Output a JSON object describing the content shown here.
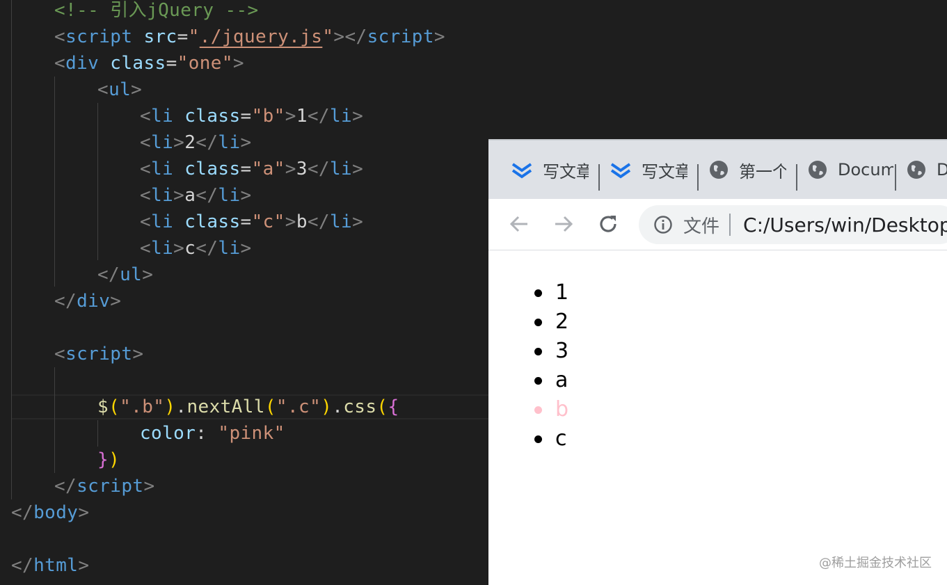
{
  "editor": {
    "lines": [
      {
        "segments": [
          {
            "c": "t-com",
            "t": "<!-- 引入jQuery -->"
          }
        ]
      },
      {
        "segments": [
          {
            "c": "t-gray",
            "t": "<"
          },
          {
            "c": "t-tag",
            "t": "script"
          },
          {
            "c": "t-text",
            "t": " "
          },
          {
            "c": "t-attr",
            "t": "src"
          },
          {
            "c": "t-text",
            "t": "="
          },
          {
            "c": "t-str",
            "t": "\""
          },
          {
            "c": "t-str ul-link",
            "t": "./jquery.js"
          },
          {
            "c": "t-str",
            "t": "\""
          },
          {
            "c": "t-gray",
            "t": "></"
          },
          {
            "c": "t-tag",
            "t": "script"
          },
          {
            "c": "t-gray",
            "t": ">"
          }
        ]
      },
      {
        "segments": [
          {
            "c": "t-gray",
            "t": "<"
          },
          {
            "c": "t-tag",
            "t": "div"
          },
          {
            "c": "t-text",
            "t": " "
          },
          {
            "c": "t-attr",
            "t": "class"
          },
          {
            "c": "t-text",
            "t": "="
          },
          {
            "c": "t-str",
            "t": "\"one\""
          },
          {
            "c": "t-gray",
            "t": ">"
          }
        ]
      },
      {
        "segments": [
          {
            "c": "t-gray",
            "t": "<"
          },
          {
            "c": "t-tag",
            "t": "ul"
          },
          {
            "c": "t-gray",
            "t": ">"
          }
        ]
      },
      {
        "segments": [
          {
            "c": "t-gray",
            "t": "<"
          },
          {
            "c": "t-tag",
            "t": "li"
          },
          {
            "c": "t-text",
            "t": " "
          },
          {
            "c": "t-attr",
            "t": "class"
          },
          {
            "c": "t-text",
            "t": "="
          },
          {
            "c": "t-str",
            "t": "\"b\""
          },
          {
            "c": "t-gray",
            "t": ">"
          },
          {
            "c": "t-text",
            "t": "1"
          },
          {
            "c": "t-gray",
            "t": "</"
          },
          {
            "c": "t-tag",
            "t": "li"
          },
          {
            "c": "t-gray",
            "t": ">"
          }
        ]
      },
      {
        "segments": [
          {
            "c": "t-gray",
            "t": "<"
          },
          {
            "c": "t-tag",
            "t": "li"
          },
          {
            "c": "t-gray",
            "t": ">"
          },
          {
            "c": "t-text",
            "t": "2"
          },
          {
            "c": "t-gray",
            "t": "</"
          },
          {
            "c": "t-tag",
            "t": "li"
          },
          {
            "c": "t-gray",
            "t": ">"
          }
        ]
      },
      {
        "segments": [
          {
            "c": "t-gray",
            "t": "<"
          },
          {
            "c": "t-tag",
            "t": "li"
          },
          {
            "c": "t-text",
            "t": " "
          },
          {
            "c": "t-attr",
            "t": "class"
          },
          {
            "c": "t-text",
            "t": "="
          },
          {
            "c": "t-str",
            "t": "\"a\""
          },
          {
            "c": "t-gray",
            "t": ">"
          },
          {
            "c": "t-text",
            "t": "3"
          },
          {
            "c": "t-gray",
            "t": "</"
          },
          {
            "c": "t-tag",
            "t": "li"
          },
          {
            "c": "t-gray",
            "t": ">"
          }
        ]
      },
      {
        "segments": [
          {
            "c": "t-gray",
            "t": "<"
          },
          {
            "c": "t-tag",
            "t": "li"
          },
          {
            "c": "t-gray",
            "t": ">"
          },
          {
            "c": "t-text",
            "t": "a"
          },
          {
            "c": "t-gray",
            "t": "</"
          },
          {
            "c": "t-tag",
            "t": "li"
          },
          {
            "c": "t-gray",
            "t": ">"
          }
        ]
      },
      {
        "segments": [
          {
            "c": "t-gray",
            "t": "<"
          },
          {
            "c": "t-tag",
            "t": "li"
          },
          {
            "c": "t-text",
            "t": " "
          },
          {
            "c": "t-attr",
            "t": "class"
          },
          {
            "c": "t-text",
            "t": "="
          },
          {
            "c": "t-str",
            "t": "\"c\""
          },
          {
            "c": "t-gray",
            "t": ">"
          },
          {
            "c": "t-text",
            "t": "b"
          },
          {
            "c": "t-gray",
            "t": "</"
          },
          {
            "c": "t-tag",
            "t": "li"
          },
          {
            "c": "t-gray",
            "t": ">"
          }
        ]
      },
      {
        "segments": [
          {
            "c": "t-gray",
            "t": "<"
          },
          {
            "c": "t-tag",
            "t": "li"
          },
          {
            "c": "t-gray",
            "t": ">"
          },
          {
            "c": "t-text",
            "t": "c"
          },
          {
            "c": "t-gray",
            "t": "</"
          },
          {
            "c": "t-tag",
            "t": "li"
          },
          {
            "c": "t-gray",
            "t": ">"
          }
        ]
      },
      {
        "segments": [
          {
            "c": "t-gray",
            "t": "</"
          },
          {
            "c": "t-tag",
            "t": "ul"
          },
          {
            "c": "t-gray",
            "t": ">"
          }
        ]
      },
      {
        "segments": [
          {
            "c": "t-gray",
            "t": "</"
          },
          {
            "c": "t-tag",
            "t": "div"
          },
          {
            "c": "t-gray",
            "t": ">"
          }
        ]
      },
      {
        "segments": []
      },
      {
        "segments": [
          {
            "c": "t-gray",
            "t": "<"
          },
          {
            "c": "t-tag",
            "t": "script"
          },
          {
            "c": "t-gray",
            "t": ">"
          }
        ]
      },
      {
        "segments": []
      },
      {
        "segments": [
          {
            "c": "t-fn",
            "t": "$"
          },
          {
            "c": "t-brk1",
            "t": "("
          },
          {
            "c": "t-str",
            "t": "\".b\""
          },
          {
            "c": "t-brk1",
            "t": ")"
          },
          {
            "c": "t-text",
            "t": "."
          },
          {
            "c": "t-fn",
            "t": "nextAll"
          },
          {
            "c": "t-brk1",
            "t": "("
          },
          {
            "c": "t-str",
            "t": "\".c\""
          },
          {
            "c": "t-brk1",
            "t": ")"
          },
          {
            "c": "t-text",
            "t": "."
          },
          {
            "c": "t-fn",
            "t": "css"
          },
          {
            "c": "t-brk1",
            "t": "("
          },
          {
            "c": "t-brk2",
            "t": "{"
          }
        ]
      },
      {
        "segments": [
          {
            "c": "t-attr",
            "t": "color"
          },
          {
            "c": "t-text",
            "t": ": "
          },
          {
            "c": "t-str",
            "t": "\"pink\""
          }
        ]
      },
      {
        "segments": [
          {
            "c": "t-brk2",
            "t": "}"
          },
          {
            "c": "t-brk1",
            "t": ")"
          }
        ]
      },
      {
        "segments": [
          {
            "c": "t-gray",
            "t": "</"
          },
          {
            "c": "t-tag",
            "t": "script"
          },
          {
            "c": "t-gray",
            "t": ">"
          }
        ]
      },
      {
        "segments": [
          {
            "c": "t-gray",
            "t": "</"
          },
          {
            "c": "t-tag",
            "t": "body"
          },
          {
            "c": "t-gray",
            "t": ">"
          }
        ]
      },
      {
        "segments": []
      },
      {
        "segments": [
          {
            "c": "t-gray",
            "t": "</"
          },
          {
            "c": "t-tag",
            "t": "html"
          },
          {
            "c": "t-gray",
            "t": ">"
          }
        ]
      }
    ]
  },
  "browser": {
    "tabs": [
      {
        "icon": "csdn-chevron-icon",
        "label": "写文章"
      },
      {
        "icon": "csdn-chevron-icon",
        "label": "写文章"
      },
      {
        "icon": "globe-icon",
        "label": "第一个"
      },
      {
        "icon": "globe-icon",
        "label": "Document"
      },
      {
        "icon": "globe-icon",
        "label": "D"
      }
    ],
    "toolbar": {
      "info_chip": "文件",
      "url": "C:/Users/win/Desktop"
    },
    "list_items": [
      {
        "text": "1",
        "color": "#000000"
      },
      {
        "text": "2",
        "color": "#000000"
      },
      {
        "text": "3",
        "color": "#000000"
      },
      {
        "text": "a",
        "color": "#000000"
      },
      {
        "text": "b",
        "color": "#ffc0cb"
      },
      {
        "text": "c",
        "color": "#000000"
      }
    ]
  },
  "watermark": "@稀土掘金技术社区"
}
